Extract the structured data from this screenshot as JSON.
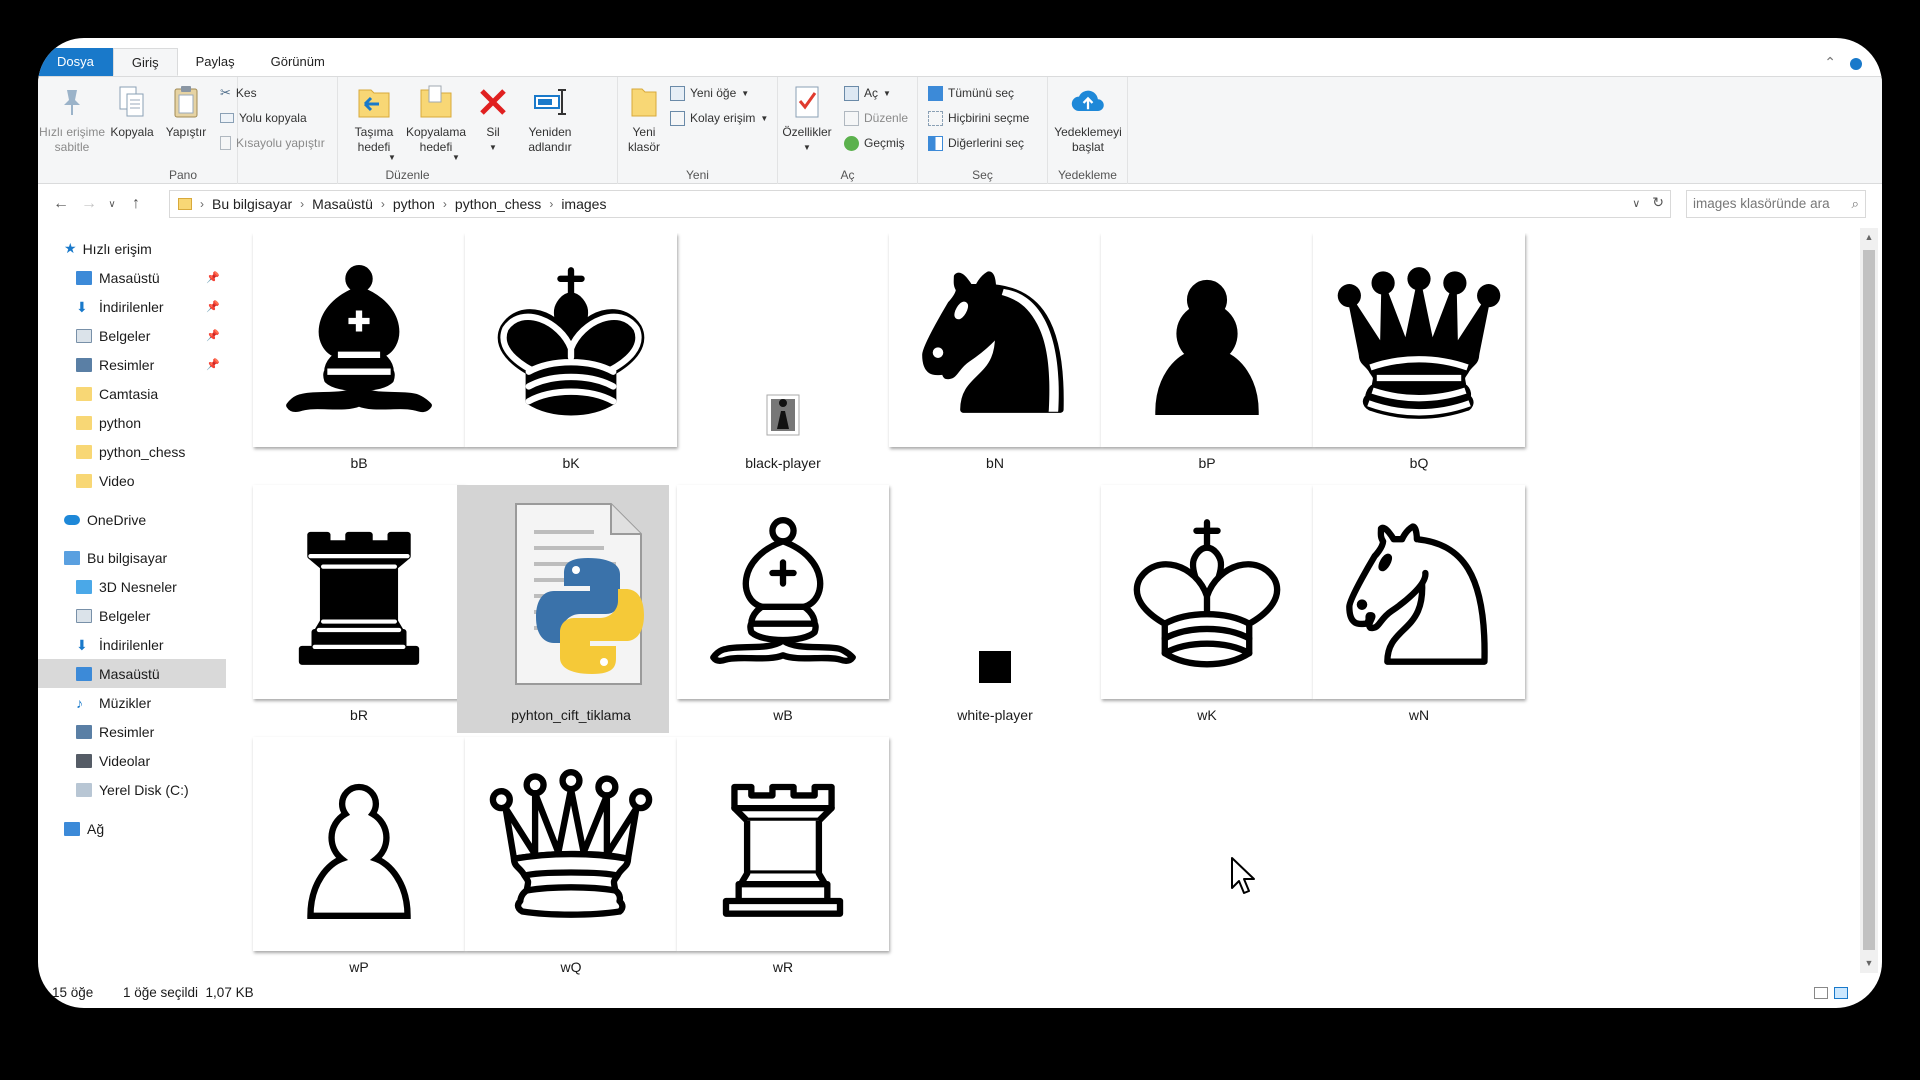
{
  "window_title": "images",
  "tabs": [
    {
      "label": "Dosya"
    },
    {
      "label": "Giriş"
    },
    {
      "label": "Paylaş"
    },
    {
      "label": "Görünüm"
    }
  ],
  "ribbon": {
    "pano": {
      "label": "Pano",
      "pin": "Hızlı erişime sabitle",
      "copy": "Kopyala",
      "paste": "Yapıştır",
      "cut": "Kes",
      "copy_path": "Yolu kopyala",
      "paste_shortcut": "Kısayolu yapıştır"
    },
    "duzenle": {
      "label": "Düzenle",
      "move_to_1": "Taşıma",
      "move_to_2": "hedefi",
      "copy_to_1": "Kopyalama",
      "copy_to_2": "hedefi",
      "delete": "Sil",
      "rename_1": "Yeniden",
      "rename_2": "adlandır"
    },
    "yeni": {
      "label": "Yeni",
      "new_folder_1": "Yeni",
      "new_folder_2": "klasör",
      "new_item": "Yeni öğe",
      "easy_access": "Kolay erişim"
    },
    "ac": {
      "label": "Aç",
      "properties": "Özellikler",
      "open": "Aç",
      "edit": "Düzenle",
      "history": "Geçmiş"
    },
    "sec": {
      "label": "Seç",
      "select_all": "Tümünü seç",
      "select_none": "Hiçbirini seçme",
      "invert": "Diğerlerini seç"
    },
    "yedekleme": {
      "label": "Yedekleme",
      "backup_1": "Yedeklemeyi",
      "backup_2": "başlat"
    }
  },
  "address": {
    "crumbs": [
      "Bu bilgisayar",
      "Masaüstü",
      "python",
      "python_chess",
      "images"
    ]
  },
  "search": {
    "placeholder": "images klasöründe ara"
  },
  "nav": {
    "quick_access": "Hızlı erişim",
    "quick_items": [
      {
        "label": "Masaüstü",
        "pinned": true
      },
      {
        "label": "İndirilenler",
        "pinned": true
      },
      {
        "label": "Belgeler",
        "pinned": true
      },
      {
        "label": "Resimler",
        "pinned": true
      },
      {
        "label": "Camtasia"
      },
      {
        "label": "python"
      },
      {
        "label": "python_chess"
      },
      {
        "label": "Video"
      }
    ],
    "onedrive": "OneDrive",
    "this_pc": "Bu bilgisayar",
    "pc_items": [
      {
        "label": "3D Nesneler"
      },
      {
        "label": "Belgeler"
      },
      {
        "label": "İndirilenler"
      },
      {
        "label": "Masaüstü"
      },
      {
        "label": "Müzikler"
      },
      {
        "label": "Resimler"
      },
      {
        "label": "Videolar"
      },
      {
        "label": "Yerel Disk (C:)"
      }
    ],
    "network": "Ağ"
  },
  "files": [
    {
      "name": "bB",
      "icon": "black-bishop"
    },
    {
      "name": "bK",
      "icon": "black-king"
    },
    {
      "name": "black-player",
      "icon": "black-player-small"
    },
    {
      "name": "bN",
      "icon": "black-knight"
    },
    {
      "name": "bP",
      "icon": "black-pawn"
    },
    {
      "name": "bQ",
      "icon": "black-queen"
    },
    {
      "name": "bR",
      "icon": "black-rook"
    },
    {
      "name": "pyhton_cift_tiklama",
      "icon": "python-file",
      "selected": true
    },
    {
      "name": "wB",
      "icon": "white-bishop"
    },
    {
      "name": "white-player",
      "icon": "white-player-small"
    },
    {
      "name": "wK",
      "icon": "white-king"
    },
    {
      "name": "wN",
      "icon": "white-knight"
    },
    {
      "name": "wP",
      "icon": "white-pawn"
    },
    {
      "name": "wQ",
      "icon": "white-queen"
    },
    {
      "name": "wR",
      "icon": "white-rook"
    }
  ],
  "status": {
    "count": "15 öğe",
    "selected": "1 öğe seçildi  1,07 KB"
  },
  "colors": {
    "accent": "#1979ca",
    "selection": "#cce8ff"
  }
}
